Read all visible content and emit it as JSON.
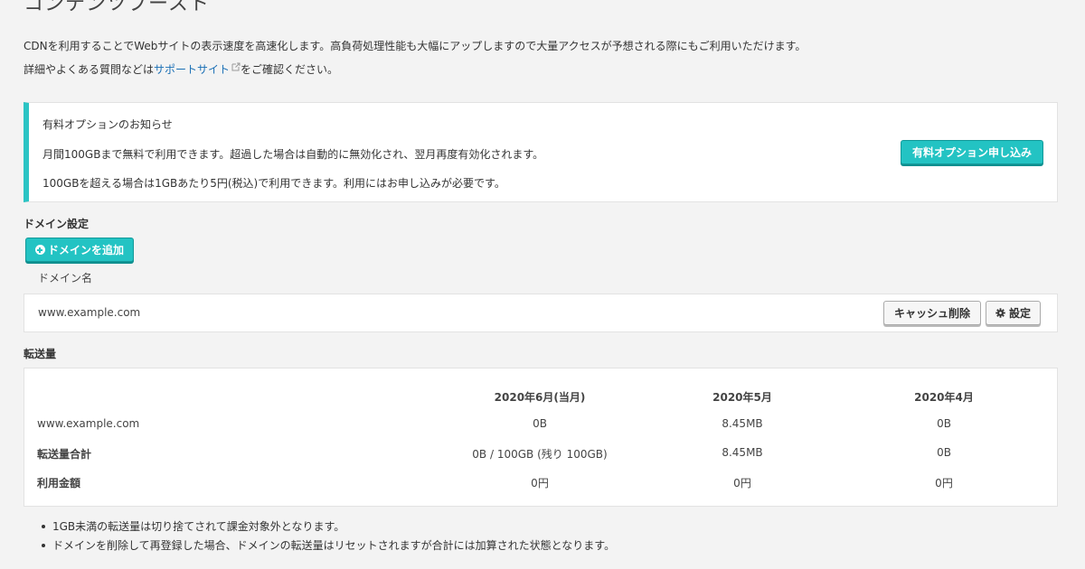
{
  "page": {
    "title": "コンテンツブースト"
  },
  "intro": {
    "line1": "CDNを利用することでWebサイトの表示速度を高速化します。高負荷処理性能も大幅にアップしますので大量アクセスが予想される際にもご利用いただけます。",
    "line2_prefix": "詳細やよくある質問などは",
    "support_link": "サポートサイト",
    "line2_suffix": "をご確認ください。"
  },
  "notice": {
    "title": "有料オプションのお知らせ",
    "line1": "月間100GBまで無料で利用できます。超過した場合は自動的に無効化され、翌月再度有効化されます。",
    "line2": "100GBを超える場合は1GBあたり5円(税込)で利用できます。利用にはお申し込みが必要です。",
    "button": "有料オプション申し込み"
  },
  "domain_settings": {
    "title": "ドメイン設定",
    "add_button": "ドメインを追加",
    "column_header": "ドメイン名",
    "rows": [
      {
        "domain": "www.example.com",
        "cache_button": "キャッシュ削除",
        "settings_button": "設定"
      }
    ]
  },
  "transfer": {
    "title": "転送量",
    "columns": [
      "2020年6月(当月)",
      "2020年5月",
      "2020年4月"
    ],
    "rows": [
      {
        "label": "www.example.com",
        "values": [
          "0B",
          "8.45MB",
          "0B"
        ],
        "bold": false
      },
      {
        "label": "転送量合計",
        "values": [
          "0B / 100GB (残り 100GB)",
          "8.45MB",
          "0B"
        ],
        "bold": true
      },
      {
        "label": "利用金額",
        "values": [
          "0円",
          "0円",
          "0円"
        ],
        "bold": true
      }
    ]
  },
  "notes": [
    "1GB未満の転送量は切り捨てされて課金対象外となります。",
    "ドメインを削除して再登録した場合、ドメインの転送量はリセットされますが合計には加算された状態となります。"
  ],
  "colors": {
    "accent": "#23c3c3",
    "link": "#1a6fb5",
    "background": "#f3f3f3"
  }
}
